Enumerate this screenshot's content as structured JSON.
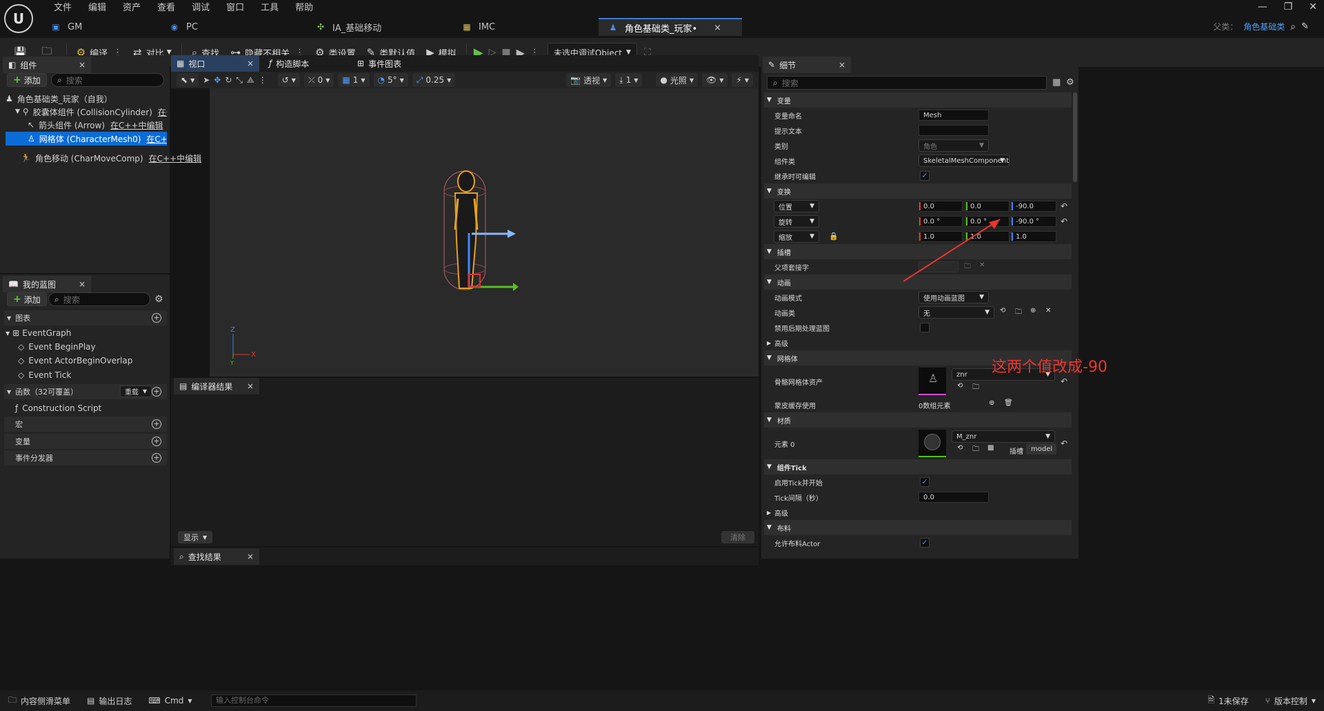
{
  "menu": [
    "文件",
    "编辑",
    "资产",
    "查看",
    "调试",
    "窗口",
    "工具",
    "帮助"
  ],
  "tabs": [
    {
      "label": "GM",
      "icon": "blueprint-icon"
    },
    {
      "label": "PC",
      "icon": "controller-icon"
    },
    {
      "label": "IA_基础移动",
      "icon": "input-action-icon"
    },
    {
      "label": "IMC",
      "icon": "mapping-context-icon"
    },
    {
      "label": "角色基础类_玩家•",
      "icon": "character-icon",
      "close": "×"
    }
  ],
  "parent": {
    "label": "父类：",
    "value": "角色基础类"
  },
  "toolbar": {
    "compile": "编译",
    "diff": "对比",
    "find": "查找",
    "hide_unrelated": "隐藏不相关",
    "class_settings": "类设置",
    "class_defaults": "类默认值",
    "simulate": "模拟",
    "debug_select": "未选中调试Object"
  },
  "components": {
    "tab": "组件",
    "add": "添加",
    "search_placeholder": "搜索",
    "items": [
      {
        "label": "角色基础类_玩家（自我）",
        "link": ""
      },
      {
        "label": "胶囊体组件 (CollisionCylinder)",
        "link": "在C++中编"
      },
      {
        "label": "箭头组件 (Arrow)",
        "link": "在C++中编辑"
      },
      {
        "label": "网格体 (CharacterMesh0)",
        "link": "在C++中编辑"
      },
      {
        "label": "角色移动 (CharMoveComp)",
        "link": "在C++中编辑"
      }
    ]
  },
  "my_blueprint": {
    "tab": "我的蓝图",
    "add": "添加",
    "search_placeholder": "搜索",
    "graphs_header": "图表",
    "event_graph": "EventGraph",
    "events": [
      "Event BeginPlay",
      "Event ActorBeginOverlap",
      "Event Tick"
    ],
    "functions_header": "函数（32可覆盖）",
    "override": "重载",
    "construction": "Construction Script",
    "macros": "宏",
    "variables": "变量",
    "dispatchers": "事件分发器"
  },
  "editor_tabs": {
    "viewport": "视口",
    "construction_script": "构造脚本",
    "event_graph": "事件图表"
  },
  "viewport_toolbar": {
    "rot_snap": "0",
    "grid": "1",
    "angle": "5°",
    "scale": "0.25",
    "perspective": "透视",
    "camera_speed": "1",
    "lighting": "光照"
  },
  "axis": {
    "z": "Z",
    "x": "X",
    "y": "Y"
  },
  "compiler": {
    "tab": "编译器结果",
    "show": "显示",
    "clear": "清除"
  },
  "find_results": {
    "tab": "查找结果"
  },
  "details": {
    "tab": "细节",
    "search_placeholder": "搜索",
    "var_section": "变量",
    "var_name_label": "变量命名",
    "var_name": "Mesh",
    "tooltip_label": "提示文本",
    "tooltip": "",
    "category_label": "类别",
    "category": "角色",
    "component_class_label": "组件类",
    "component_class": "SkeletalMeshComponent",
    "editable_label": "继承时可编辑",
    "transform_section": "变换",
    "location_label": "位置",
    "location": [
      "0.0",
      "0.0",
      "-90.0"
    ],
    "rotation_label": "旋转",
    "rotation": [
      "0.0 °",
      "0.0 °",
      "-90.0 °"
    ],
    "scale_label": "缩放",
    "scale": [
      "1.0",
      "1.0",
      "1.0"
    ],
    "socket_section": "插槽",
    "parent_socket_label": "父项套接字",
    "anim_section": "动画",
    "anim_mode_label": "动画模式",
    "anim_mode": "使用动画蓝图",
    "anim_class_label": "动画类",
    "anim_class": "无",
    "disable_post_label": "禁用后期处理蓝图",
    "advanced": "高级",
    "mesh_section": "网格体",
    "skeletal_mesh_label": "骨骼网格体资产",
    "skeletal_mesh": "znr",
    "skin_cache_label": "蒙皮缓存使用",
    "skin_cache": "0数组元素",
    "material_section": "材质",
    "element0_label": "元素 0",
    "element0": "M_znr",
    "slot_label": "插槽",
    "slot_value": "model",
    "tick_section": "组件Tick",
    "start_tick_label": "启用Tick并开始",
    "tick_interval_label": "Tick间隔（秒）",
    "tick_interval": "0.0",
    "advanced2": "高级",
    "cloth_section": "布料",
    "allow_cloth_label": "允许布料Actor"
  },
  "annotation": {
    "text": "这两个值改成-90",
    "color": "#e8362f"
  },
  "statusbar": {
    "content_drawer": "内容侧滑菜单",
    "output_log": "输出日志",
    "cmd": "Cmd",
    "console_placeholder": "输入控制台命令",
    "unsaved": "1未保存",
    "source_control": "版本控制"
  },
  "colors": {
    "accent": "#0b6cd6",
    "play": "#65c14a",
    "selection": "#0b6cd6"
  }
}
